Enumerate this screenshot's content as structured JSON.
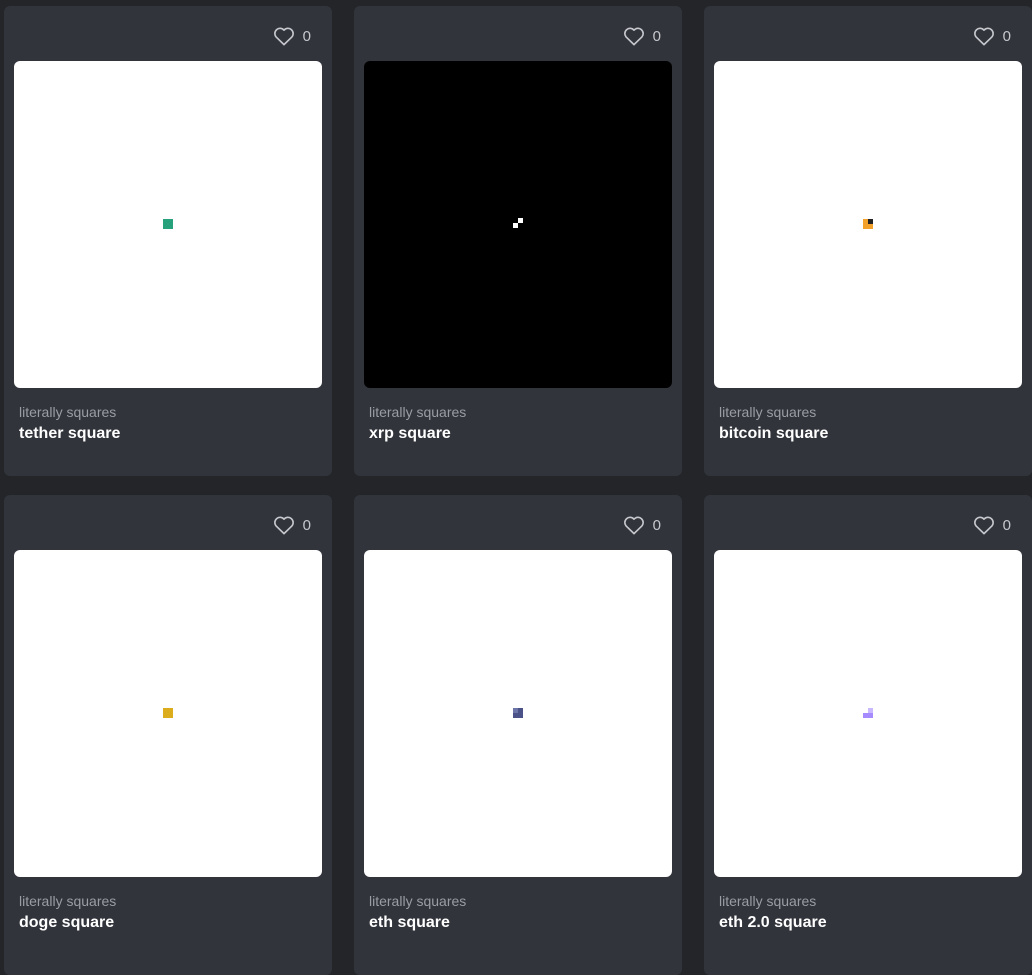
{
  "cards": [
    {
      "collection": "literally squares",
      "title": "tether square",
      "likes": "0",
      "art_bg": "#ffffff",
      "icon": "heart-outline-icon"
    },
    {
      "collection": "literally squares",
      "title": "xrp square",
      "likes": "0",
      "art_bg": "#000000",
      "icon": "heart-outline-icon"
    },
    {
      "collection": "literally squares",
      "title": "bitcoin square",
      "likes": "0",
      "art_bg": "#ffffff",
      "icon": "heart-outline-icon"
    },
    {
      "collection": "literally squares",
      "title": "doge square",
      "likes": "0",
      "art_bg": "#ffffff",
      "icon": "heart-outline-icon"
    },
    {
      "collection": "literally squares",
      "title": "eth square",
      "likes": "0",
      "art_bg": "#ffffff",
      "icon": "heart-outline-icon"
    },
    {
      "collection": "literally squares",
      "title": "eth 2.0 square",
      "likes": "0",
      "art_bg": "#ffffff",
      "icon": "heart-outline-icon"
    }
  ],
  "colors": {
    "page_bg": "#232529",
    "card_bg": "#31343b",
    "tether": "#26a17b",
    "xrp": "#ffffff",
    "bitcoin_orange": "#f2a22a",
    "bitcoin_dark": "#222222",
    "doge": "#dbac1c",
    "eth": "#4a5287",
    "eth2": "#a68bff"
  }
}
